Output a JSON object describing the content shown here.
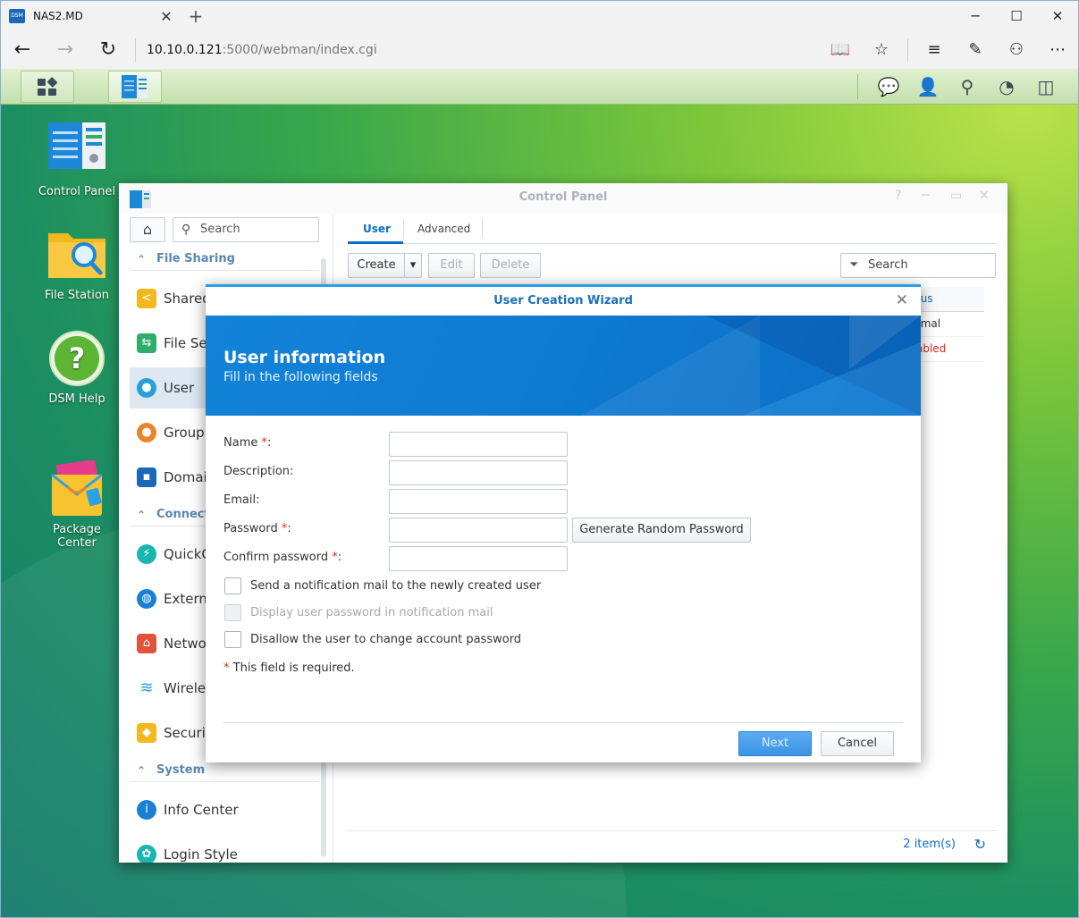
{
  "browser": {
    "tab_title": "NAS2.MD",
    "favicon_text": "DSM",
    "url_host": "10.10.0.121",
    "url_rest": ":5000/webman/index.cgi"
  },
  "desktop": {
    "icons": [
      {
        "label": "Control Panel"
      },
      {
        "label": "File Station"
      },
      {
        "label": "DSM Help"
      },
      {
        "label": "Package\nCenter"
      }
    ]
  },
  "control_panel": {
    "title": "Control Panel",
    "search_placeholder": "Search",
    "sections": {
      "file_sharing": "File Sharing",
      "connectivity": "Connect",
      "system": "System"
    },
    "items": {
      "shared": "Shared",
      "file_services": "File Se",
      "user": "User",
      "group": "Group",
      "domain": "Domai",
      "quickconnect": "QuickC",
      "external": "Externa",
      "network": "Networ",
      "wireless": "Wireles",
      "security": "Securit",
      "info_center": "Info Center",
      "login_style": "Login Style"
    },
    "tabs": {
      "user": "User",
      "advanced": "Advanced"
    },
    "toolbar": {
      "create": "Create",
      "edit": "Edit",
      "delete": "Delete",
      "search": "Search"
    },
    "grid": {
      "status_header": "tus",
      "rows": [
        {
          "status": "rmal",
          "color": "#333333"
        },
        {
          "status": "abled",
          "color": "#e02b20"
        }
      ]
    },
    "footer": {
      "count": "2 item(s)"
    }
  },
  "wizard": {
    "title": "User Creation Wizard",
    "heading": "User information",
    "subheading": "Fill in the following fields",
    "fields": {
      "name": "Name",
      "description": "Description:",
      "email": "Email:",
      "password": "Password",
      "confirm_password": "Confirm password",
      "required_mark": "*",
      "colon": ":"
    },
    "generate_button": "Generate Random Password",
    "checkboxes": {
      "notify": "Send a notification mail to the newly created user",
      "display_password": "Display user password in notification mail",
      "disallow_change": "Disallow the user to change account password"
    },
    "required_note": "This field is required.",
    "next": "Next",
    "cancel": "Cancel"
  },
  "colors": {
    "accent": "#0a6fc2",
    "banner": "#0f7bd2",
    "required": "#e02b20"
  },
  "icons": [
    "tab-close-icon",
    "new-tab-icon",
    "minimize-icon",
    "maximize-icon",
    "window-close-icon",
    "back-icon",
    "forward-icon",
    "refresh-icon",
    "reading-view-icon",
    "favorite-star-icon",
    "hub-icon",
    "web-note-icon",
    "share-icon",
    "more-icon",
    "main-menu-icon",
    "chat-icon",
    "user-icon",
    "search-icon",
    "dashboard-icon",
    "widgets-icon",
    "home-icon",
    "filter-icon",
    "refresh-grid-icon",
    "close-icon"
  ]
}
